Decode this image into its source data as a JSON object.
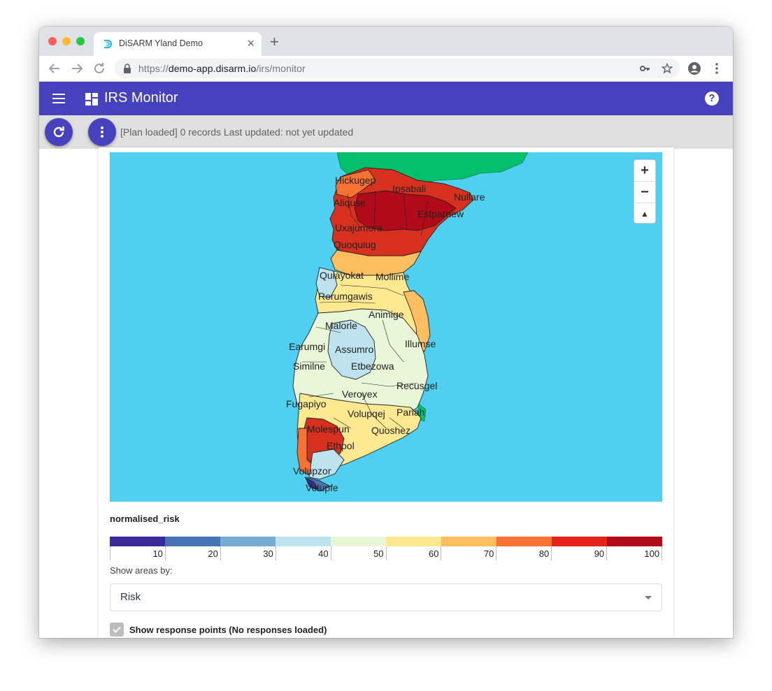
{
  "browser": {
    "tab_title": "DiSARM Yland Demo",
    "tab_close": "×",
    "new_tab": "+",
    "url_prefix": "https://",
    "url_domain": "demo-app.disarm.io",
    "url_path": "/irs/monitor",
    "icons": [
      "back-icon",
      "forward-icon",
      "reload-icon",
      "lock-icon",
      "key-icon",
      "star-icon",
      "profile-icon",
      "menu-dots-icon"
    ]
  },
  "app": {
    "title": "IRS Monitor",
    "help": "?",
    "brand_color": "#4641bc"
  },
  "status": {
    "text": "[Plan loaded] 0 records Last updated: not yet updated"
  },
  "map": {
    "zoom_in": "+",
    "zoom_out": "−",
    "reset_north": "▲",
    "labels": [
      "Hickugep",
      "Ipsabali",
      "Nullare",
      "Aliquse",
      "Estparnew",
      "Uxajumora",
      "Quoquiug",
      "Quiayokat",
      "Mollime",
      "Rerumgawis",
      "Animige",
      "Malorle",
      "Earumgi",
      "Assumro",
      "Illumse",
      "Similne",
      "Etbezowa",
      "Recusgel",
      "Veroyex",
      "Fugapiyo",
      "Volupqej",
      "Pariah",
      "Molespun",
      "Quoshez",
      "Ethpol",
      "Volupzor",
      "Volupfe"
    ]
  },
  "legend": {
    "title": "normalised_risk",
    "colors": [
      "#3a2a9a",
      "#4575b4",
      "#74add1",
      "#bde3ee",
      "#e9f6d8",
      "#fee990",
      "#fdbe5f",
      "#f87333",
      "#e3231c",
      "#b20a18"
    ],
    "ticks": [
      "10",
      "20",
      "30",
      "40",
      "50",
      "60",
      "70",
      "80",
      "90",
      "100"
    ]
  },
  "controls": {
    "show_areas_label": "Show areas by:",
    "selected": "Risk",
    "checkbox_label": "Show response points (No responses loaded)",
    "checkbox_checked": true
  }
}
